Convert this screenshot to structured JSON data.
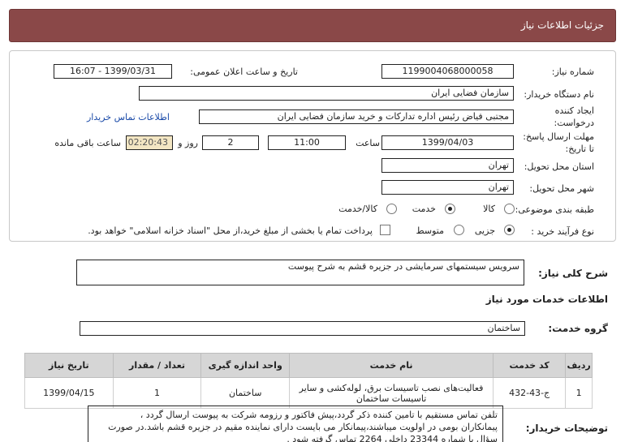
{
  "header": {
    "title": "جزئیات اطلاعات نیاز"
  },
  "fields": {
    "need_number_label": "شماره نیاز:",
    "need_number": "1199004068000058",
    "announce_label": "تاریخ و ساعت اعلان عمومی:",
    "announce_value": "1399/03/31 - 16:07",
    "buyer_org_label": "نام دستگاه خریدار:",
    "buyer_org": "سازمان فضایی ایران",
    "requester_label_1": "ایجاد کننده",
    "requester_label_2": "درخواست:",
    "requester": "مجتبی  فیاض رئیس اداره تدارکات و خرید سازمان فضایی ایران",
    "buyer_contact_link": "اطلاعات تماس خریدار",
    "deadline_label_1": "مهلت ارسال پاسخ:",
    "deadline_label_2": "تا تاریخ:",
    "deadline_date": "1399/04/03",
    "time_label": "ساعت",
    "deadline_time": "11:00",
    "days_value": "2",
    "days_label": "روز و",
    "remaining_time": "02:20:43",
    "remaining_label": "ساعت باقی مانده",
    "province_label": "استان محل تحویل:",
    "province": "تهران",
    "city_label": "شهر محل تحویل:",
    "city": "تهران",
    "category_label": "طبقه بندی موضوعی:",
    "category_options": [
      "کالا",
      "خدمت",
      "کالا/خدمت"
    ],
    "process_label": "نوع فرآیند خرید :",
    "process_options": [
      "جزیی",
      "متوسط"
    ],
    "payment_note": "پرداخت تمام یا بخشی از مبلغ خرید،از محل \"اسناد خزانه اسلامی\" خواهد بود."
  },
  "summary": {
    "label": "شرح کلی نیاز:",
    "value": "سرویس سیستمهای سرمایشی در جزیره قشم به شرح پیوست"
  },
  "services_heading": "اطلاعات خدمات مورد نیاز",
  "service_group": {
    "label": "گروه خدمت:",
    "value": "ساختمان"
  },
  "table": {
    "headers": [
      "ردیف",
      "کد خدمت",
      "نام خدمت",
      "واحد اندازه گیری",
      "تعداد / مقدار",
      "تاریخ نیاز"
    ],
    "row": {
      "index": "1",
      "code": "ج-43-432",
      "name_line1": "فعالیت‌های نصب تاسیسات برق، لوله‌کشی و سایر",
      "name_line2": "تاسیسات ساختمان",
      "unit": "ساختمان",
      "qty": "1",
      "date": "1399/04/15"
    }
  },
  "buyer_notes": {
    "label": "توضیحات خریدار:",
    "lines": [
      "تلفن تماس مستقیم با تامین کننده ذکر گردد،پیش فاکتور و رزومه شرکت به پیوست ارسال گردد ،",
      "پیمانکاران بومی در اولویت میباشند،پیمانکار می بایست دارای نماینده مقیم در جزیره قشم باشد.در صورت",
      "سؤال با شماره 23344 داخلی 2264 تماس گرفته شود ."
    ]
  },
  "colors": {
    "header_bg": "#8a4848",
    "remaining_bg": "#f3e6c3",
    "link": "#1a4aa8"
  }
}
